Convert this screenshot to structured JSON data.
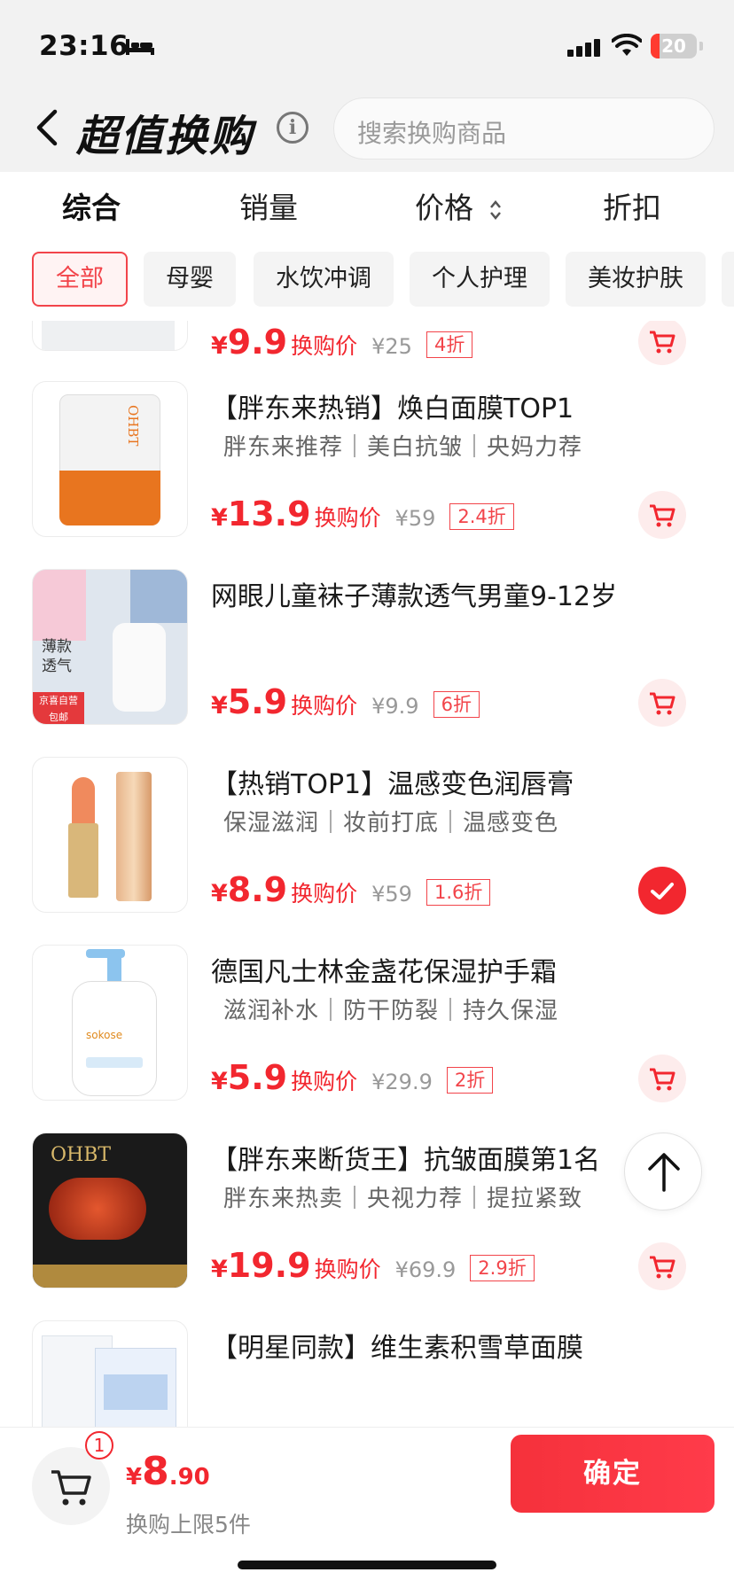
{
  "status": {
    "time": "23:16",
    "battery": "20",
    "battery_fraction": 0.2
  },
  "header": {
    "title": "超值换购",
    "search_placeholder": "搜索换购商品"
  },
  "sort_tabs": [
    "综合",
    "销量",
    "价格",
    "折扣"
  ],
  "categories": [
    "全部",
    "母婴",
    "水饮冲调",
    "个人护理",
    "美妆护肤"
  ],
  "products": [
    {
      "name": "",
      "tags": "",
      "price": "9.9",
      "price_label": "换购价",
      "original": "¥25",
      "discount": "4折",
      "action": "cart"
    },
    {
      "name": "【胖东来热销】焕白面膜TOP1",
      "tags": "胖东来推荐｜美白抗皱｜央妈力荐",
      "price": "13.9",
      "price_label": "换购价",
      "original": "¥59",
      "discount": "2.4折",
      "action": "cart"
    },
    {
      "name": "网眼儿童袜子薄款透气男童9-12岁",
      "tags": "",
      "price": "5.9",
      "price_label": "换购价",
      "original": "¥9.9",
      "discount": "6折",
      "action": "cart",
      "thumb_text": {
        "a": "薄款",
        "b": "透气",
        "c": "京喜自营",
        "d": "包邮"
      }
    },
    {
      "name": "【热销TOP1】温感变色润唇膏",
      "tags": "保湿滋润｜妆前打底｜温感变色",
      "price": "8.9",
      "price_label": "换购价",
      "original": "¥59",
      "discount": "1.6折",
      "action": "checked"
    },
    {
      "name": "德国凡士林金盏花保湿护手霜",
      "tags": "滋润补水｜防干防裂｜持久保湿",
      "price": "5.9",
      "price_label": "换购价",
      "original": "¥29.9",
      "discount": "2折",
      "action": "cart",
      "thumb_text": {
        "a": "sokose"
      }
    },
    {
      "name": "【胖东来断货王】抗皱面膜第1名",
      "tags": "胖东来热卖｜央视力荐｜提拉紧致",
      "price": "19.9",
      "price_label": "换购价",
      "original": "¥69.9",
      "discount": "2.9折",
      "action": "cart",
      "thumb_text": {
        "a": "OHBT"
      }
    },
    {
      "name": "【明星同款】维生素积雪草面膜",
      "tags": "",
      "price": "",
      "price_label": "",
      "original": "",
      "discount": "",
      "action": "none"
    }
  ],
  "thumb_brand_text": "OHBT",
  "bottom": {
    "cart_count": "1",
    "currency": "¥",
    "total_int": "8",
    "total_dec": ".90",
    "limit_text": "换购上限5件",
    "confirm_label": "确定"
  },
  "colors": {
    "accent": "#f2272f",
    "accent_soft": "#fdecec",
    "header_bg": "#f2f2f2"
  },
  "icons": [
    "back-arrow-icon",
    "info-icon",
    "sort-arrows-icon",
    "cart-icon",
    "check-icon",
    "arrow-up-icon"
  ]
}
